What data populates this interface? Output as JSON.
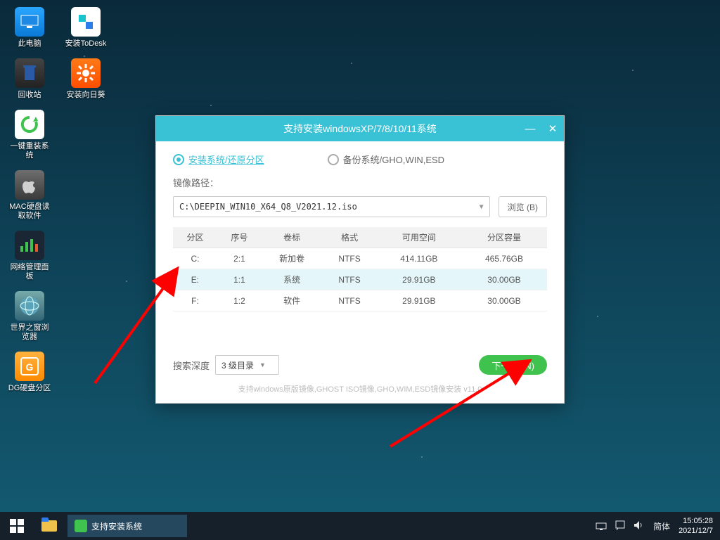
{
  "desktop_icons": {
    "col1": [
      "此电脑",
      "回收站",
      "一键重装系统",
      "MAC硬盘读取软件",
      "网络管理面板",
      "世界之窗浏览器",
      "DG硬盘分区"
    ],
    "col2": [
      "安装ToDesk",
      "安装向日葵"
    ]
  },
  "window": {
    "title": "支持安装windowsXP/7/8/10/11系统",
    "radio_install": "安装系统/还原分区",
    "radio_backup": "备份系统/GHO,WIN,ESD",
    "image_path_label": "镜像路径：",
    "image_path": "C:\\DEEPIN_WIN10_X64_Q8_V2021.12.iso",
    "browse": "浏览 (B)",
    "headers": {
      "part": "分区",
      "index": "序号",
      "label": "卷标",
      "fs": "格式",
      "free": "可用空间",
      "total": "分区容量"
    },
    "rows": [
      {
        "part": "C:",
        "index": "2:1",
        "label": "新加卷",
        "fs": "NTFS",
        "free": "414.11GB",
        "total": "465.76GB",
        "selected": false
      },
      {
        "part": "E:",
        "index": "1:1",
        "label": "系统",
        "fs": "NTFS",
        "free": "29.91GB",
        "total": "30.00GB",
        "selected": true
      },
      {
        "part": "F:",
        "index": "1:2",
        "label": "软件",
        "fs": "NTFS",
        "free": "29.91GB",
        "total": "30.00GB",
        "selected": false
      }
    ],
    "depth_label": "搜索深度",
    "depth_value": "3 级目录",
    "next": "下一步 (N)",
    "footer": "支持windows原版镜像,GHOST ISO镜像,GHO,WIM,ESD镜像安装  v11.0"
  },
  "taskbar": {
    "task_label": "支持安装系统",
    "ime": "简体",
    "time": "15:05:28",
    "date": "2021/12/7"
  }
}
